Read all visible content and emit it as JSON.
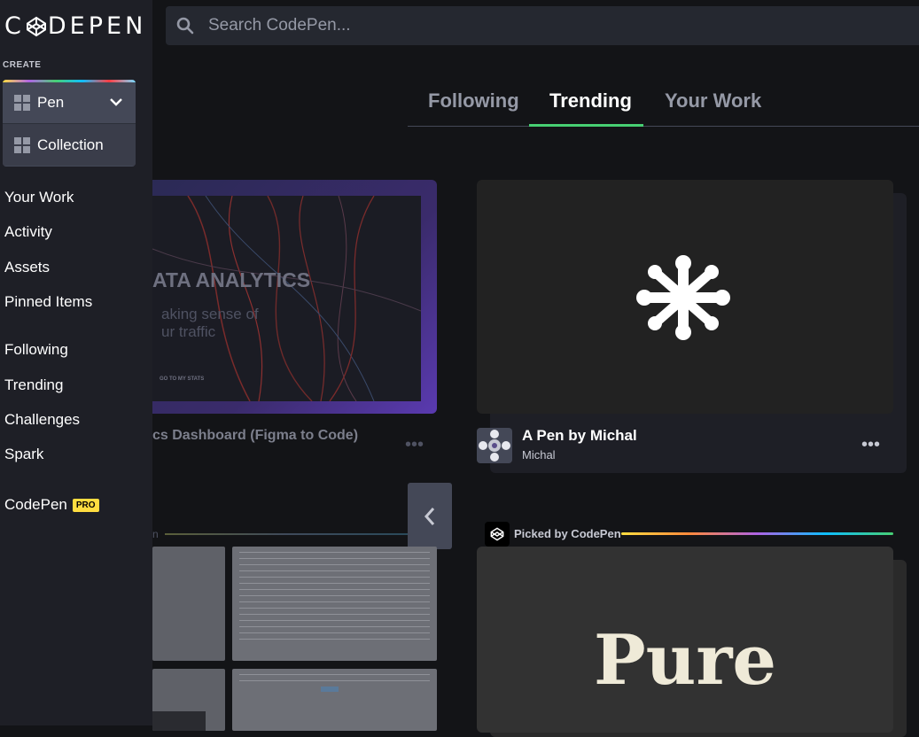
{
  "brand": {
    "logo_letters": [
      "C",
      "D",
      "E",
      "P",
      "E",
      "N"
    ]
  },
  "search": {
    "placeholder": "Search CodePen..."
  },
  "sidebar": {
    "create_label": "CREATE",
    "create_items": [
      {
        "label": "Pen",
        "icon": "grid-icon"
      },
      {
        "label": "Collection",
        "icon": "grid-icon"
      }
    ],
    "nav_group_1": [
      "Your Work",
      "Activity",
      "Assets",
      "Pinned Items"
    ],
    "nav_group_2": [
      "Following",
      "Trending",
      "Challenges",
      "Spark"
    ],
    "codepen_pro": {
      "label": "CodePen",
      "badge": "PRO"
    }
  },
  "tabs": [
    {
      "label": "Following",
      "active": false
    },
    {
      "label": "Trending",
      "active": true
    },
    {
      "label": "Your Work",
      "active": false
    }
  ],
  "cards": {
    "left": {
      "preview_title": "ATA ANALYTICS",
      "preview_sub_1": "aking sense of",
      "preview_sub_2": "ur traffic",
      "preview_link": "GO TO MY STATS",
      "title": "cs Dashboard (Figma to Code)",
      "more": "•••"
    },
    "right": {
      "title": "A Pen by Michal",
      "author": "Michal",
      "more": "•••"
    }
  },
  "lower": {
    "left_label": "n",
    "picked_label": "Picked by CodePen",
    "pure_text": "Pure"
  },
  "colors": {
    "accent_green": "#47cf73",
    "pro_yellow": "#ffdd40",
    "background": "#131417",
    "sidebar": "#1e1f26"
  }
}
